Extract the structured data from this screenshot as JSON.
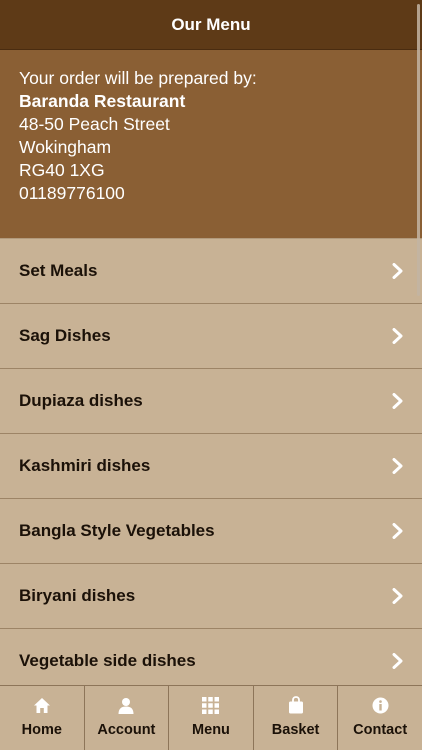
{
  "header": {
    "title": "Our Menu"
  },
  "info": {
    "intro": "Your order will be prepared by:",
    "restaurant_name": "Baranda Restaurant",
    "address_line1": "48-50 Peach Street",
    "address_line2": "Wokingham",
    "postcode": "RG40 1XG",
    "phone": "01189776100"
  },
  "menu": {
    "items": [
      {
        "label": "Set Meals"
      },
      {
        "label": "Sag Dishes"
      },
      {
        "label": "Dupiaza dishes"
      },
      {
        "label": "Kashmiri dishes"
      },
      {
        "label": "Bangla Style Vegetables"
      },
      {
        "label": "Biryani dishes"
      },
      {
        "label": "Vegetable side dishes"
      }
    ]
  },
  "tabbar": {
    "tabs": [
      {
        "label": "Home",
        "icon": "home-icon"
      },
      {
        "label": "Account",
        "icon": "user-icon"
      },
      {
        "label": "Menu",
        "icon": "grid-icon"
      },
      {
        "label": "Basket",
        "icon": "bag-icon"
      },
      {
        "label": "Contact",
        "icon": "info-icon"
      }
    ]
  },
  "colors": {
    "header_bg": "#5e3a17",
    "info_bg": "#8a5f34",
    "list_bg": "#c8b295",
    "text_dark": "#1b1108",
    "text_light": "#ffffff"
  }
}
